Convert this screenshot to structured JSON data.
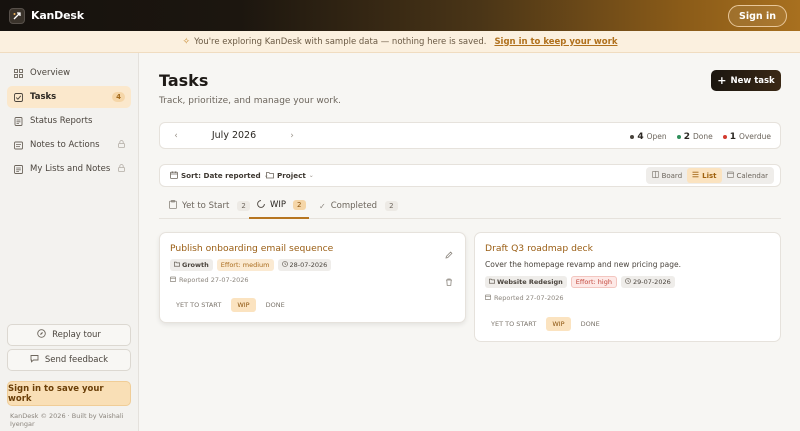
{
  "app": {
    "name": "KanDesk",
    "signin_label": "Sign in"
  },
  "banner": {
    "text": "You're exploring KanDesk with sample data — nothing here is saved.",
    "link": "Sign in to keep your work"
  },
  "sidebar": {
    "items": [
      {
        "label": "Overview",
        "icon": "grid-icon"
      },
      {
        "label": "Tasks",
        "icon": "checkbox-icon",
        "badge": "4"
      },
      {
        "label": "Status Reports",
        "icon": "document-icon"
      },
      {
        "label": "Notes to Actions",
        "icon": "notes-icon"
      },
      {
        "label": "My Lists and Notes",
        "icon": "list-icon"
      }
    ],
    "replay_tour": "Replay tour",
    "send_feedback": "Send feedback",
    "signin_save": "Sign in to save your work",
    "copyright": "KanDesk © 2026 · Built by Vaishali Iyengar"
  },
  "main": {
    "title": "Tasks",
    "subtitle": "Track, prioritize, and manage your work.",
    "new_task": "New task",
    "month": "July 2026",
    "stats": [
      {
        "count": "4",
        "label": "Open",
        "color": "#4a443d"
      },
      {
        "count": "2",
        "label": "Done",
        "color": "#2f8f5b"
      },
      {
        "count": "1",
        "label": "Overdue",
        "color": "#d23b2f"
      }
    ],
    "toolbar": {
      "sort": "Sort: Date reported",
      "project": "Project",
      "views": [
        "Board",
        "List",
        "Calendar"
      ],
      "active_view": "List"
    },
    "tabs": [
      {
        "label": "Yet to Start",
        "count": "2"
      },
      {
        "label": "WIP",
        "count": "2"
      },
      {
        "label": "Completed",
        "count": "2"
      }
    ],
    "active_tab": "WIP",
    "cards": [
      {
        "title": "Publish onboarding email sequence",
        "project": "Growth",
        "effort": "Effort: medium",
        "due": "28-07-2026",
        "reported": "Reported 27-07-2026",
        "statuses": [
          "YET TO START",
          "WIP",
          "DONE"
        ],
        "active_status": "WIP"
      },
      {
        "title": "Draft Q3 roadmap deck",
        "description": "Cover the homepage revamp and new pricing page.",
        "project": "Website Redesign",
        "effort": "Effort: high",
        "due": "29-07-2026",
        "reported": "Reported 27-07-2026",
        "statuses": [
          "YET TO START",
          "WIP",
          "DONE"
        ],
        "active_status": "WIP"
      }
    ]
  }
}
